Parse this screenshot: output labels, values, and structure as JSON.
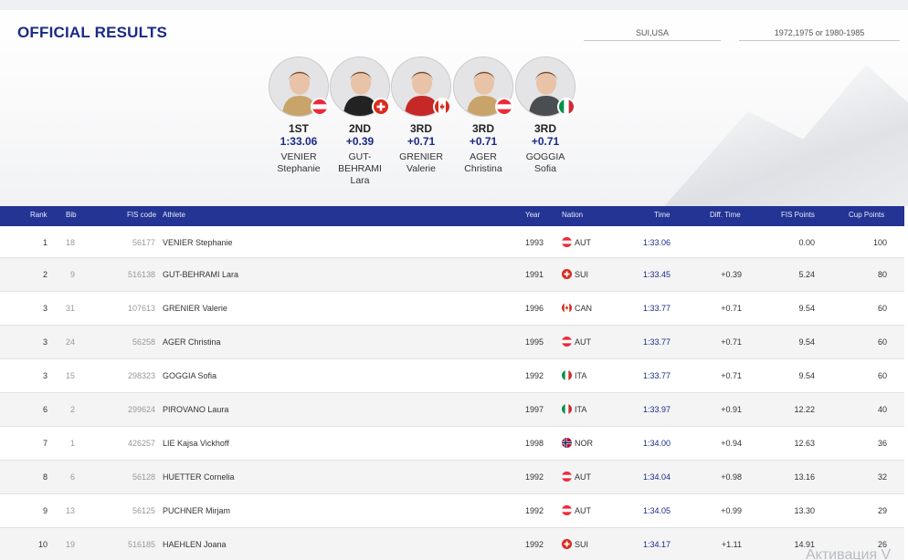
{
  "title": "OFFICIAL RESULTS",
  "filters": {
    "nation": "SUI,USA",
    "season": "1972,1975 or 1980-1985"
  },
  "podium": [
    {
      "rank": "1ST",
      "time": "1:33.06",
      "last": "VENIER",
      "first": "Stephanie",
      "nation": "AUT",
      "suit": "#c9a46a"
    },
    {
      "rank": "2ND",
      "time": "+0.39",
      "last": "GUT-\nBEHRAMI",
      "first": "Lara",
      "nation": "SUI",
      "suit": "#222222"
    },
    {
      "rank": "3RD",
      "time": "+0.71",
      "last": "GRENIER",
      "first": "Valerie",
      "nation": "CAN",
      "suit": "#c62828"
    },
    {
      "rank": "3RD",
      "time": "+0.71",
      "last": "AGER",
      "first": "Christina",
      "nation": "AUT",
      "suit": "#c9a46a"
    },
    {
      "rank": "3RD",
      "time": "+0.71",
      "last": "GOGGIA",
      "first": "Sofia",
      "nation": "ITA",
      "suit": "#4a4d52"
    }
  ],
  "columns": {
    "rank": "Rank",
    "bib": "Bib",
    "fis_code": "FIS code",
    "athlete": "Athlete",
    "year": "Year",
    "nation": "Nation",
    "time": "Time",
    "diff": "Diff. Time",
    "fis_points": "FIS Points",
    "cup_points": "Cup Points"
  },
  "results": [
    {
      "rank": "1",
      "bib": "18",
      "fis": "56177",
      "athlete": "VENIER Stephanie",
      "year": "1993",
      "nation": "AUT",
      "time": "1:33.06",
      "diff": "",
      "fis_points": "0.00",
      "cup_points": "100"
    },
    {
      "rank": "2",
      "bib": "9",
      "fis": "516138",
      "athlete": "GUT-BEHRAMI Lara",
      "year": "1991",
      "nation": "SUI",
      "time": "1:33.45",
      "diff": "+0.39",
      "fis_points": "5.24",
      "cup_points": "80"
    },
    {
      "rank": "3",
      "bib": "31",
      "fis": "107613",
      "athlete": "GRENIER Valerie",
      "year": "1996",
      "nation": "CAN",
      "time": "1:33.77",
      "diff": "+0.71",
      "fis_points": "9.54",
      "cup_points": "60"
    },
    {
      "rank": "3",
      "bib": "24",
      "fis": "56258",
      "athlete": "AGER Christina",
      "year": "1995",
      "nation": "AUT",
      "time": "1:33.77",
      "diff": "+0.71",
      "fis_points": "9.54",
      "cup_points": "60"
    },
    {
      "rank": "3",
      "bib": "15",
      "fis": "298323",
      "athlete": "GOGGIA Sofia",
      "year": "1992",
      "nation": "ITA",
      "time": "1:33.77",
      "diff": "+0.71",
      "fis_points": "9.54",
      "cup_points": "60"
    },
    {
      "rank": "6",
      "bib": "2",
      "fis": "299624",
      "athlete": "PIROVANO Laura",
      "year": "1997",
      "nation": "ITA",
      "time": "1:33.97",
      "diff": "+0.91",
      "fis_points": "12.22",
      "cup_points": "40"
    },
    {
      "rank": "7",
      "bib": "1",
      "fis": "426257",
      "athlete": "LIE Kajsa Vickhoff",
      "year": "1998",
      "nation": "NOR",
      "time": "1:34.00",
      "diff": "+0.94",
      "fis_points": "12.63",
      "cup_points": "36"
    },
    {
      "rank": "8",
      "bib": "6",
      "fis": "56128",
      "athlete": "HUETTER Cornelia",
      "year": "1992",
      "nation": "AUT",
      "time": "1:34.04",
      "diff": "+0.98",
      "fis_points": "13.16",
      "cup_points": "32"
    },
    {
      "rank": "9",
      "bib": "13",
      "fis": "56125",
      "athlete": "PUCHNER Mirjam",
      "year": "1992",
      "nation": "AUT",
      "time": "1:34.05",
      "diff": "+0.99",
      "fis_points": "13.30",
      "cup_points": "29"
    },
    {
      "rank": "10",
      "bib": "19",
      "fis": "516185",
      "athlete": "HAEHLEN Joana",
      "year": "1992",
      "nation": "SUI",
      "time": "1:34.17",
      "diff": "+1.11",
      "fis_points": "14.91",
      "cup_points": "26"
    }
  ],
  "watermark": "Активация V",
  "colors": {
    "header_bg": "#233494",
    "title": "#1b2a86",
    "time_text": "#1b2a86"
  }
}
